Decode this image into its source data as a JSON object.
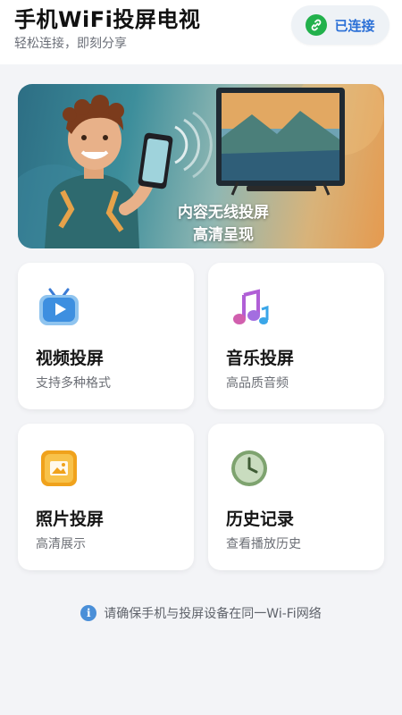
{
  "header": {
    "title": "手机WiFi投屏电视",
    "subtitle": "轻松连接，即刻分享",
    "connection": {
      "label": "已连接",
      "icon": "link-icon",
      "icon_color": "#22b14c",
      "text_color": "#2a6fd6"
    }
  },
  "banner": {
    "caption_line1": "内容无线投屏",
    "caption_line2": "高清呈现"
  },
  "features": [
    {
      "title": "视频投屏",
      "subtitle": "支持多种格式",
      "icon": "tv-play-icon"
    },
    {
      "title": "音乐投屏",
      "subtitle": "高品质音频",
      "icon": "music-note-icon"
    },
    {
      "title": "照片投屏",
      "subtitle": "高清展示",
      "icon": "photo-icon"
    },
    {
      "title": "历史记录",
      "subtitle": "查看播放历史",
      "icon": "clock-icon"
    }
  ],
  "tip": {
    "icon": "info-icon",
    "text": "请确保手机与投屏设备在同一Wi-Fi网络"
  }
}
